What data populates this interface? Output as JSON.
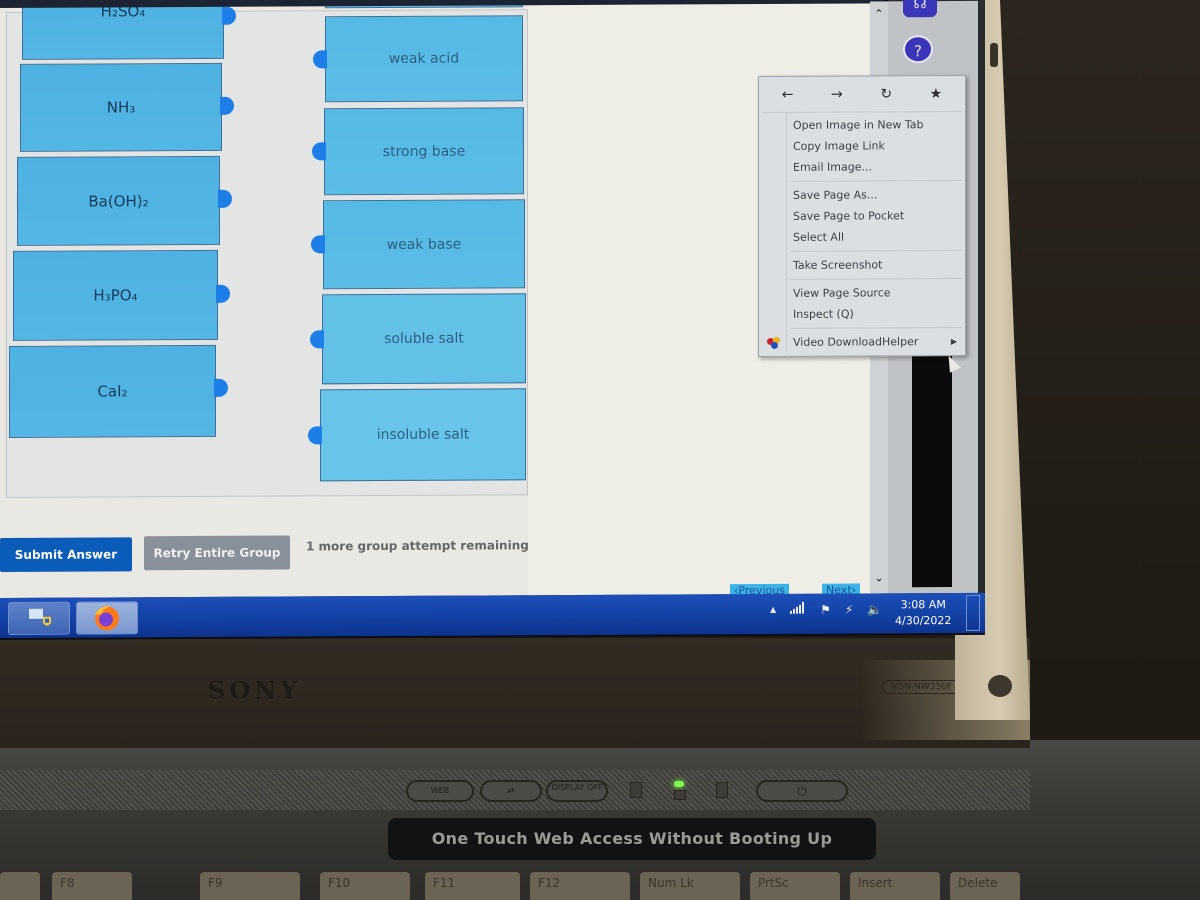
{
  "question": {
    "left_items": [
      {
        "label": "H₂SO₄"
      },
      {
        "label": "NH₃"
      },
      {
        "label": "Ba(OH)₂"
      },
      {
        "label": "H₃PO₄"
      },
      {
        "label": "CaI₂"
      }
    ],
    "right_items": [
      {
        "label": "weak acid"
      },
      {
        "label": "strong base"
      },
      {
        "label": "weak base"
      },
      {
        "label": "soluble salt"
      },
      {
        "label": "insoluble salt"
      }
    ],
    "submit_label": "Submit Answer",
    "retry_label": "Retry Entire Group",
    "attempts_text": "1 more group attempt remaining",
    "prev_label": "Previous",
    "next_label": "Next"
  },
  "context_menu": {
    "nav_icons": [
      "back-arrow",
      "forward-arrow",
      "reload",
      "bookmark-star"
    ],
    "nav_glyphs": {
      "back": "←",
      "forward": "→",
      "reload": "↻",
      "bookmark": "★"
    },
    "groups": [
      [
        "Open Image in New Tab",
        "Copy Image Link",
        "Email Image..."
      ],
      [
        "Save Page As...",
        "Save Page to Pocket",
        "Select All"
      ],
      [
        "Take Screenshot"
      ],
      [
        "View Page Source",
        "Inspect (Q)"
      ]
    ],
    "extension_item": "Video DownloadHelper"
  },
  "sidebar_icons": {
    "headset": "☊",
    "help": "?"
  },
  "taskbar": {
    "time": "3:08 AM",
    "date": "4/30/2022",
    "tray_glyphs": {
      "expand": "▲",
      "signal": "▐",
      "flag": "⚑",
      "power": "⚡",
      "volume": "🔈"
    }
  },
  "hardware": {
    "brand": "SONY",
    "model": "VGN-NW350F",
    "banner": "One Touch Web Access Without Booting Up",
    "buttons": [
      "WEB",
      "⇄",
      "DISPLAY OFF"
    ],
    "keys": [
      "F8",
      "F9",
      "F10",
      "F11",
      "F12",
      "Num Lk",
      "PrtSc",
      "Insert",
      "Delete"
    ]
  },
  "colors": {
    "accent_blue": "#0b5cb8",
    "box_blue": "#4db1e2",
    "handle_blue": "#1e7ee8",
    "taskbar_blue": "#1442a6"
  }
}
